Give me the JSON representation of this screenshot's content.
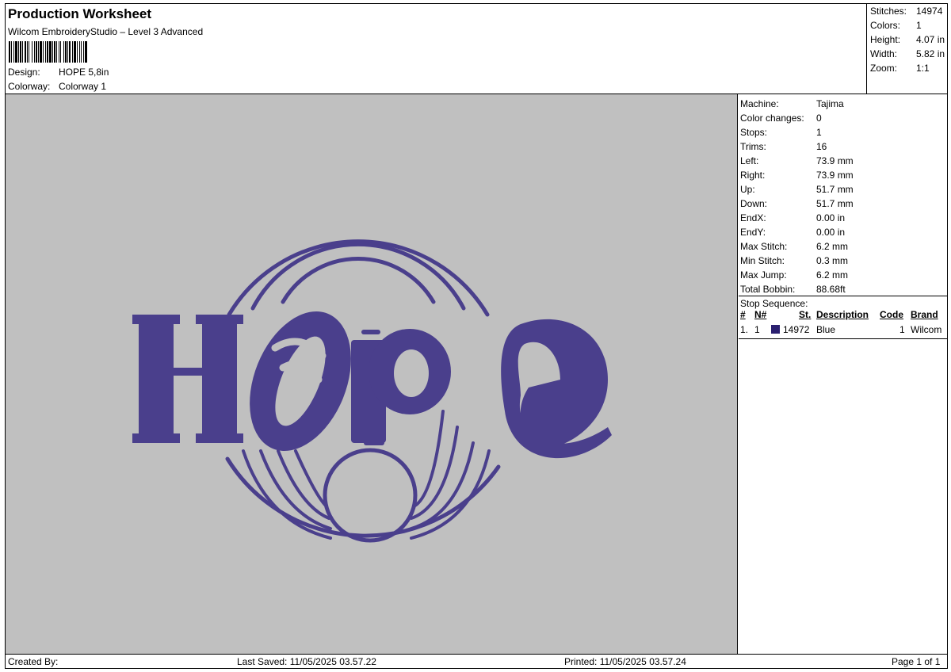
{
  "header": {
    "title": "Production Worksheet",
    "software": "Wilcom EmbroideryStudio – Level 3 Advanced",
    "design_label": "Design:",
    "design_value": "HOPE 5,8in",
    "colorway_label": "Colorway:",
    "colorway_value": "Colorway 1"
  },
  "stats": [
    {
      "label": "Stitches:",
      "value": "14974"
    },
    {
      "label": "Colors:",
      "value": "1"
    },
    {
      "label": "Height:",
      "value": "4.07 in"
    },
    {
      "label": "Width:",
      "value": "5.82 in"
    },
    {
      "label": "Zoom:",
      "value": "1:1"
    }
  ],
  "machine_info": [
    {
      "label": "Machine:",
      "value": "Tajima"
    },
    {
      "label": "Color changes:",
      "value": "0"
    },
    {
      "label": "Stops:",
      "value": "1"
    },
    {
      "label": "Trims:",
      "value": "16"
    },
    {
      "label": "Left:",
      "value": "73.9 mm"
    },
    {
      "label": "Right:",
      "value": "73.9 mm"
    },
    {
      "label": "Up:",
      "value": "51.7 mm"
    },
    {
      "label": "Down:",
      "value": "51.7 mm"
    },
    {
      "label": "EndX:",
      "value": "0.00 in"
    },
    {
      "label": "EndY:",
      "value": "0.00 in"
    },
    {
      "label": "Max Stitch:",
      "value": "6.2 mm"
    },
    {
      "label": "Min Stitch:",
      "value": "0.3 mm"
    },
    {
      "label": "Max Jump:",
      "value": "6.2 mm"
    },
    {
      "label": "Total Bobbin:",
      "value": "88.68ft"
    }
  ],
  "stop_sequence": {
    "title": "Stop Sequence:",
    "columns": {
      "num": "#",
      "needle": "N#",
      "stitches": "St.",
      "description": "Description",
      "code": "Code",
      "brand": "Brand"
    },
    "rows": [
      {
        "num": "1.",
        "needle": "1",
        "stitches": "14972",
        "description": "Blue",
        "code": "1",
        "brand": "Wilcom",
        "color": "#2b2070"
      }
    ]
  },
  "design": {
    "text": "HOPE",
    "thread_color": "#4a3f8c",
    "background_color": "#c0c0c0"
  },
  "footer": {
    "created_by": "Created By:",
    "last_saved": "Last Saved: 11/05/2025 03.57.22",
    "printed": "Printed: 11/05/2025 03.57.24",
    "page": "Page 1 of 1"
  }
}
